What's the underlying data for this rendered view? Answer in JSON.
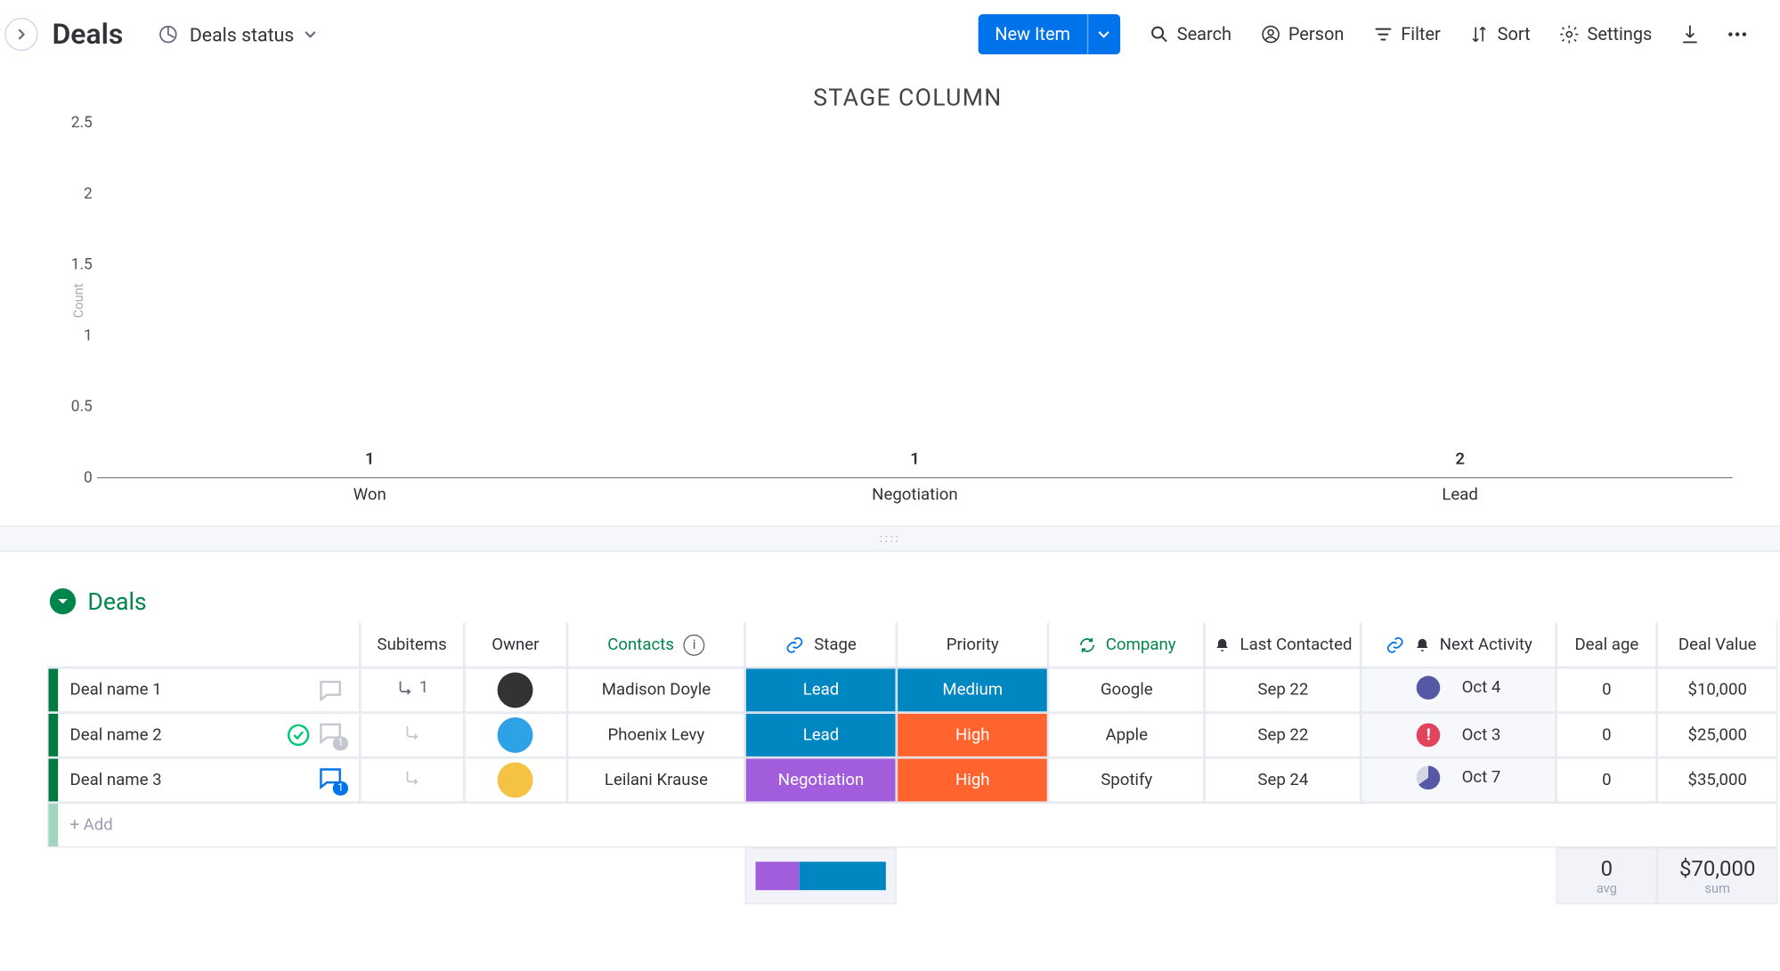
{
  "header": {
    "board_title": "Deals",
    "view_label": "Deals status",
    "new_item": "New Item",
    "actions": {
      "search": "Search",
      "person": "Person",
      "filter": "Filter",
      "sort": "Sort",
      "settings": "Settings"
    }
  },
  "chart_data": {
    "type": "bar",
    "title": "STAGE COLUMN",
    "ylabel": "Count",
    "ylim": [
      0,
      2.5
    ],
    "yticks": [
      0,
      0.5,
      1,
      1.5,
      2,
      2.5
    ],
    "categories": [
      "Won",
      "Negotiation",
      "Lead"
    ],
    "values": [
      1,
      1,
      2
    ],
    "colors": [
      "#00c875",
      "#a25ddc",
      "#0086c0"
    ]
  },
  "group": {
    "name": "Deals",
    "columns": {
      "subitems": "Subitems",
      "owner": "Owner",
      "contacts": "Contacts",
      "stage": "Stage",
      "priority": "Priority",
      "company": "Company",
      "last_contacted": "Last Contacted",
      "next_activity": "Next Activity",
      "deal_age": "Deal age",
      "deal_value": "Deal Value"
    },
    "rows": [
      {
        "name": "Deal name 1",
        "subitems_count": "1",
        "owner_color": "#333",
        "contact": "Madison Doyle",
        "stage": "Lead",
        "stage_class": "lead",
        "priority": "Medium",
        "priority_class": "med",
        "company": "Google",
        "last_contacted": "Sep 22",
        "activity_status": "dot-dark",
        "activity_status_color": "#5559a5",
        "next_activity": "Oct 4",
        "deal_age": "0",
        "deal_value": "$10,000"
      },
      {
        "name": "Deal name 2",
        "subitems_count": "",
        "owner_color": "#2ea2e6",
        "contact": "Phoenix Levy",
        "stage": "Lead",
        "stage_class": "lead",
        "priority": "High",
        "priority_class": "high",
        "company": "Apple",
        "last_contacted": "Sep 22",
        "activity_status": "alert",
        "activity_status_color": "#e2445c",
        "next_activity": "Oct 3",
        "deal_age": "0",
        "deal_value": "$25,000"
      },
      {
        "name": "Deal name 3",
        "subitems_count": "",
        "owner_color": "#f5c344",
        "contact": "Leilani Krause",
        "stage": "Negotiation",
        "stage_class": "neg",
        "priority": "High",
        "priority_class": "high",
        "company": "Spotify",
        "last_contacted": "Sep 24",
        "activity_status": "pie",
        "activity_status_color": "#5559a5",
        "next_activity": "Oct 7",
        "deal_age": "0",
        "deal_value": "$35,000"
      }
    ],
    "add_label": "+ Add",
    "footer": {
      "deal_age_avg": "0",
      "deal_age_label": "avg",
      "deal_value_sum": "$70,000",
      "deal_value_label": "sum"
    }
  }
}
